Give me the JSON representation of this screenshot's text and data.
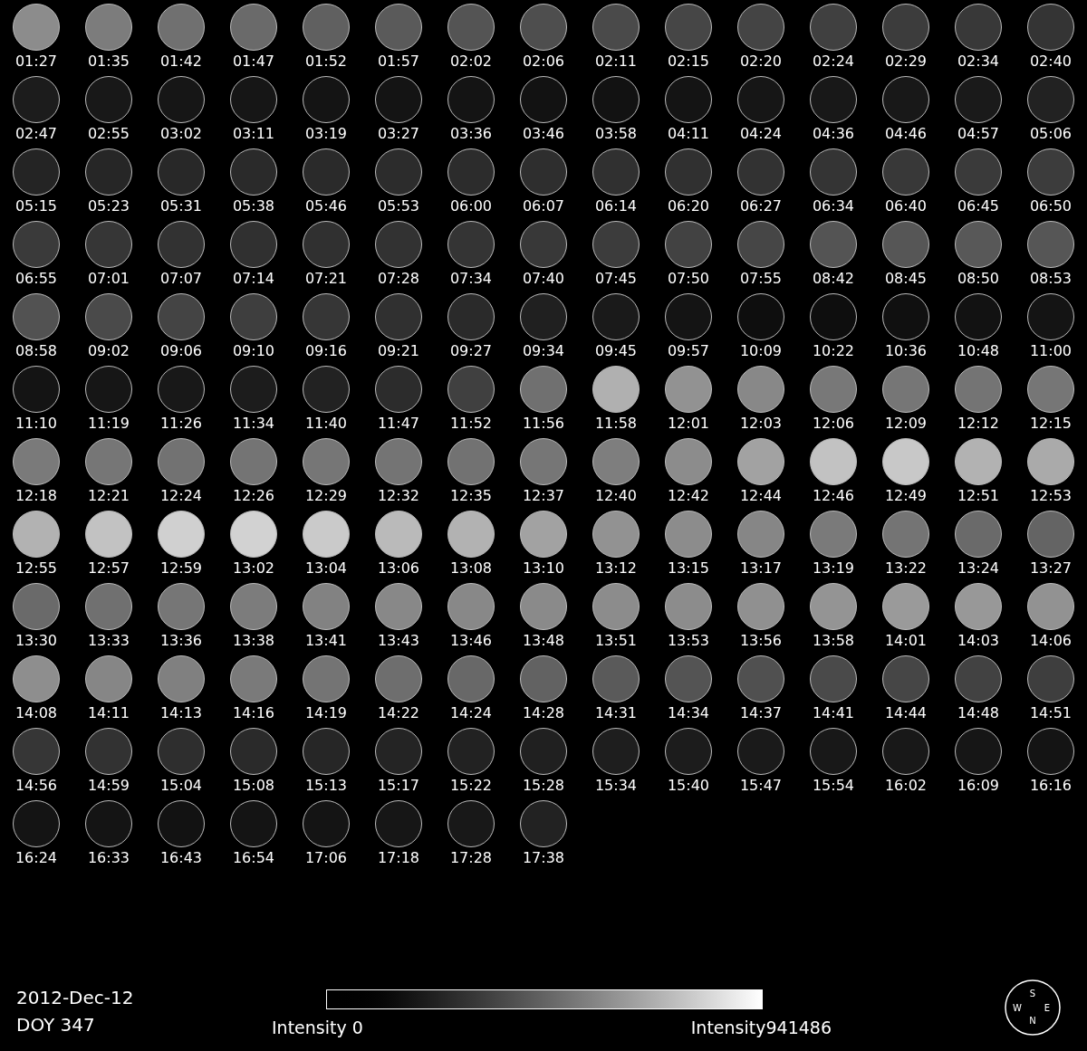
{
  "images": [
    {
      "time": "01:27",
      "color": "#8c8c8c"
    },
    {
      "time": "01:35",
      "color": "#7c7c7c"
    },
    {
      "time": "01:42",
      "color": "#707070"
    },
    {
      "time": "01:47",
      "color": "#6a6a6a"
    },
    {
      "time": "01:52",
      "color": "#606060"
    },
    {
      "time": "01:57",
      "color": "#5a5a5a"
    },
    {
      "time": "02:02",
      "color": "#545454"
    },
    {
      "time": "02:06",
      "color": "#4e4e4e"
    },
    {
      "time": "02:11",
      "color": "#4a4a4a"
    },
    {
      "time": "02:15",
      "color": "#464646"
    },
    {
      "time": "02:20",
      "color": "#444444"
    },
    {
      "time": "02:24",
      "color": "#404040"
    },
    {
      "time": "02:29",
      "color": "#3c3c3c"
    },
    {
      "time": "02:34",
      "color": "#383838"
    },
    {
      "time": "02:40",
      "color": "#343434"
    },
    {
      "time": "02:47",
      "color": "#1c1c1c"
    },
    {
      "time": "02:55",
      "color": "#181818"
    },
    {
      "time": "03:02",
      "color": "#161616"
    },
    {
      "time": "03:11",
      "color": "#161616"
    },
    {
      "time": "03:19",
      "color": "#141414"
    },
    {
      "time": "03:27",
      "color": "#141414"
    },
    {
      "time": "03:36",
      "color": "#141414"
    },
    {
      "time": "03:46",
      "color": "#121212"
    },
    {
      "time": "03:58",
      "color": "#121212"
    },
    {
      "time": "04:11",
      "color": "#141414"
    },
    {
      "time": "04:24",
      "color": "#161616"
    },
    {
      "time": "04:36",
      "color": "#181818"
    },
    {
      "time": "04:46",
      "color": "#181818"
    },
    {
      "time": "04:57",
      "color": "#1a1a1a"
    },
    {
      "time": "05:06",
      "color": "#222222"
    },
    {
      "time": "05:15",
      "color": "#242424"
    },
    {
      "time": "05:23",
      "color": "#262626"
    },
    {
      "time": "05:31",
      "color": "#282828"
    },
    {
      "time": "05:38",
      "color": "#2a2a2a"
    },
    {
      "time": "05:46",
      "color": "#2a2a2a"
    },
    {
      "time": "05:53",
      "color": "#2c2c2c"
    },
    {
      "time": "06:00",
      "color": "#2c2c2c"
    },
    {
      "time": "06:07",
      "color": "#2e2e2e"
    },
    {
      "time": "06:14",
      "color": "#303030"
    },
    {
      "time": "06:20",
      "color": "#303030"
    },
    {
      "time": "06:27",
      "color": "#323232"
    },
    {
      "time": "06:34",
      "color": "#343434"
    },
    {
      "time": "06:40",
      "color": "#383838"
    },
    {
      "time": "06:45",
      "color": "#3a3a3a"
    },
    {
      "time": "06:50",
      "color": "#3c3c3c"
    },
    {
      "time": "06:55",
      "color": "#3a3a3a"
    },
    {
      "time": "07:01",
      "color": "#363636"
    },
    {
      "time": "07:07",
      "color": "#323232"
    },
    {
      "time": "07:14",
      "color": "#303030"
    },
    {
      "time": "07:21",
      "color": "#303030"
    },
    {
      "time": "07:28",
      "color": "#323232"
    },
    {
      "time": "07:34",
      "color": "#343434"
    },
    {
      "time": "07:40",
      "color": "#383838"
    },
    {
      "time": "07:45",
      "color": "#3c3c3c"
    },
    {
      "time": "07:50",
      "color": "#424242"
    },
    {
      "time": "07:55",
      "color": "#464646"
    },
    {
      "time": "08:42",
      "color": "#545454"
    },
    {
      "time": "08:45",
      "color": "#565656"
    },
    {
      "time": "08:50",
      "color": "#585858"
    },
    {
      "time": "08:53",
      "color": "#565656"
    },
    {
      "time": "08:58",
      "color": "#525252"
    },
    {
      "time": "09:02",
      "color": "#4a4a4a"
    },
    {
      "time": "09:06",
      "color": "#444444"
    },
    {
      "time": "09:10",
      "color": "#3e3e3e"
    },
    {
      "time": "09:16",
      "color": "#363636"
    },
    {
      "time": "09:21",
      "color": "#303030"
    },
    {
      "time": "09:27",
      "color": "#2a2a2a"
    },
    {
      "time": "09:34",
      "color": "#202020"
    },
    {
      "time": "09:45",
      "color": "#1a1a1a"
    },
    {
      "time": "09:57",
      "color": "#141414"
    },
    {
      "time": "10:09",
      "color": "#0e0e0e"
    },
    {
      "time": "10:22",
      "color": "#0e0e0e"
    },
    {
      "time": "10:36",
      "color": "#101010"
    },
    {
      "time": "10:48",
      "color": "#121212"
    },
    {
      "time": "11:00",
      "color": "#141414"
    },
    {
      "time": "11:10",
      "color": "#141414"
    },
    {
      "time": "11:19",
      "color": "#161616"
    },
    {
      "time": "11:26",
      "color": "#181818"
    },
    {
      "time": "11:34",
      "color": "#1c1c1c"
    },
    {
      "time": "11:40",
      "color": "#222222"
    },
    {
      "time": "11:47",
      "color": "#2c2c2c"
    },
    {
      "time": "11:52",
      "color": "#404040"
    },
    {
      "time": "11:56",
      "color": "#707070"
    },
    {
      "time": "11:58",
      "color": "#b0b0b0"
    },
    {
      "time": "12:01",
      "color": "#929292"
    },
    {
      "time": "12:03",
      "color": "#888888"
    },
    {
      "time": "12:06",
      "color": "#787878"
    },
    {
      "time": "12:09",
      "color": "#767676"
    },
    {
      "time": "12:12",
      "color": "#747474"
    },
    {
      "time": "12:15",
      "color": "#767676"
    },
    {
      "time": "12:18",
      "color": "#7a7a7a"
    },
    {
      "time": "12:21",
      "color": "#767676"
    },
    {
      "time": "12:24",
      "color": "#727272"
    },
    {
      "time": "12:26",
      "color": "#747474"
    },
    {
      "time": "12:29",
      "color": "#767676"
    },
    {
      "time": "12:32",
      "color": "#747474"
    },
    {
      "time": "12:35",
      "color": "#727272"
    },
    {
      "time": "12:37",
      "color": "#767676"
    },
    {
      "time": "12:40",
      "color": "#7e7e7e"
    },
    {
      "time": "12:42",
      "color": "#8c8c8c"
    },
    {
      "time": "12:44",
      "color": "#a2a2a2"
    },
    {
      "time": "12:46",
      "color": "#c2c2c2"
    },
    {
      "time": "12:49",
      "color": "#c8c8c8"
    },
    {
      "time": "12:51",
      "color": "#b2b2b2"
    },
    {
      "time": "12:53",
      "color": "#aaaaaa"
    },
    {
      "time": "12:55",
      "color": "#b2b2b2"
    },
    {
      "time": "12:57",
      "color": "#c2c2c2"
    },
    {
      "time": "12:59",
      "color": "#d0d0d0"
    },
    {
      "time": "13:02",
      "color": "#d2d2d2"
    },
    {
      "time": "13:04",
      "color": "#cacaca"
    },
    {
      "time": "13:06",
      "color": "#bababa"
    },
    {
      "time": "13:08",
      "color": "#b2b2b2"
    },
    {
      "time": "13:10",
      "color": "#a2a2a2"
    },
    {
      "time": "13:12",
      "color": "#929292"
    },
    {
      "time": "13:15",
      "color": "#8c8c8c"
    },
    {
      "time": "13:17",
      "color": "#868686"
    },
    {
      "time": "13:19",
      "color": "#7a7a7a"
    },
    {
      "time": "13:22",
      "color": "#747474"
    },
    {
      "time": "13:24",
      "color": "#6a6a6a"
    },
    {
      "time": "13:27",
      "color": "#646464"
    },
    {
      "time": "13:30",
      "color": "#6a6a6a"
    },
    {
      "time": "13:33",
      "color": "#707070"
    },
    {
      "time": "13:36",
      "color": "#767676"
    },
    {
      "time": "13:38",
      "color": "#7c7c7c"
    },
    {
      "time": "13:41",
      "color": "#828282"
    },
    {
      "time": "13:43",
      "color": "#888888"
    },
    {
      "time": "13:46",
      "color": "#888888"
    },
    {
      "time": "13:48",
      "color": "#8a8a8a"
    },
    {
      "time": "13:51",
      "color": "#8c8c8c"
    },
    {
      "time": "13:53",
      "color": "#8c8c8c"
    },
    {
      "time": "13:56",
      "color": "#909090"
    },
    {
      "time": "13:58",
      "color": "#949494"
    },
    {
      "time": "14:01",
      "color": "#9a9a9a"
    },
    {
      "time": "14:03",
      "color": "#989898"
    },
    {
      "time": "14:06",
      "color": "#929292"
    },
    {
      "time": "14:08",
      "color": "#8e8e8e"
    },
    {
      "time": "14:11",
      "color": "#868686"
    },
    {
      "time": "14:13",
      "color": "#808080"
    },
    {
      "time": "14:16",
      "color": "#7a7a7a"
    },
    {
      "time": "14:19",
      "color": "#747474"
    },
    {
      "time": "14:22",
      "color": "#6e6e6e"
    },
    {
      "time": "14:24",
      "color": "#686868"
    },
    {
      "time": "14:28",
      "color": "#626262"
    },
    {
      "time": "14:31",
      "color": "#5a5a5a"
    },
    {
      "time": "14:34",
      "color": "#545454"
    },
    {
      "time": "14:37",
      "color": "#505050"
    },
    {
      "time": "14:41",
      "color": "#4a4a4a"
    },
    {
      "time": "14:44",
      "color": "#464646"
    },
    {
      "time": "14:48",
      "color": "#424242"
    },
    {
      "time": "14:51",
      "color": "#3e3e3e"
    },
    {
      "time": "14:56",
      "color": "#363636"
    },
    {
      "time": "14:59",
      "color": "#323232"
    },
    {
      "time": "15:04",
      "color": "#2e2e2e"
    },
    {
      "time": "15:08",
      "color": "#2a2a2a"
    },
    {
      "time": "15:13",
      "color": "#262626"
    },
    {
      "time": "15:17",
      "color": "#242424"
    },
    {
      "time": "15:22",
      "color": "#222222"
    },
    {
      "time": "15:28",
      "color": "#202020"
    },
    {
      "time": "15:34",
      "color": "#1e1e1e"
    },
    {
      "time": "15:40",
      "color": "#1c1c1c"
    },
    {
      "time": "15:47",
      "color": "#1a1a1a"
    },
    {
      "time": "15:54",
      "color": "#181818"
    },
    {
      "time": "16:02",
      "color": "#181818"
    },
    {
      "time": "16:09",
      "color": "#161616"
    },
    {
      "time": "16:16",
      "color": "#141414"
    },
    {
      "time": "16:24",
      "color": "#141414"
    },
    {
      "time": "16:33",
      "color": "#141414"
    },
    {
      "time": "16:43",
      "color": "#121212"
    },
    {
      "time": "16:54",
      "color": "#141414"
    },
    {
      "time": "17:06",
      "color": "#141414"
    },
    {
      "time": "17:18",
      "color": "#161616"
    },
    {
      "time": "17:28",
      "color": "#181818"
    },
    {
      "time": "17:38",
      "color": "#222222"
    }
  ],
  "date": "2012-Dec-12",
  "doy": "DOY 347",
  "colorbar": {
    "min_label": "Intensity 0",
    "max_label": "Intensity941486"
  },
  "compass": {
    "top": "S",
    "left": "W",
    "right": "E",
    "bottom": "N"
  }
}
